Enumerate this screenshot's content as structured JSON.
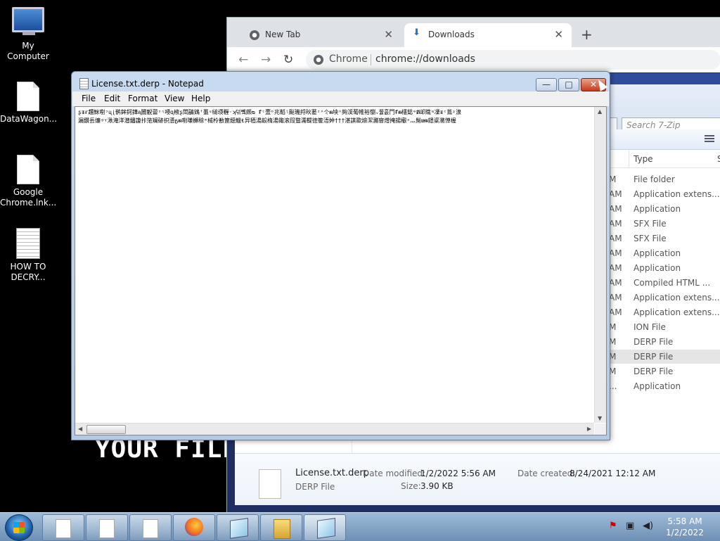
{
  "desktop": {
    "icons": [
      {
        "label": "My Computer",
        "icon": "computer-icon"
      },
      {
        "label": "DataWagon...",
        "icon": "document-icon"
      },
      {
        "label": "Google Chrome.lnk...",
        "icon": "document-icon"
      },
      {
        "label": "HOW TO DECRY...",
        "icon": "text-document-icon"
      }
    ],
    "wallpaper_text": "YOUR FILE"
  },
  "chrome": {
    "tabs": [
      {
        "label": "New Tab",
        "icon": "chrome-icon",
        "close": "✕"
      },
      {
        "label": "Downloads",
        "icon": "download-icon",
        "close": "✕"
      }
    ],
    "new_tab": "+",
    "nav": {
      "back": "←",
      "forward": "→",
      "reload": "↻"
    },
    "omnibox": {
      "site_label": "Chrome",
      "url": "chrome://downloads"
    }
  },
  "explorer": {
    "search_placeholder": "Search 7-Zip",
    "column_type": "Type",
    "column_more": "S",
    "rows": [
      {
        "time": "M",
        "type": "File folder"
      },
      {
        "time": "AM",
        "type": "Application extens..."
      },
      {
        "time": "AM",
        "type": "Application"
      },
      {
        "time": "AM",
        "type": "SFX File"
      },
      {
        "time": "AM",
        "type": "SFX File"
      },
      {
        "time": "AM",
        "type": "Application"
      },
      {
        "time": "AM",
        "type": "Application"
      },
      {
        "time": "AM",
        "type": "Compiled HTML ..."
      },
      {
        "time": "AM",
        "type": "Application extens..."
      },
      {
        "time": "AM",
        "type": "Application extens..."
      },
      {
        "time": "M",
        "type": "ION File"
      },
      {
        "time": "M",
        "type": "DERP File"
      },
      {
        "time": "M",
        "type": "DERP File",
        "selected": true
      },
      {
        "time": "M",
        "type": "DERP File"
      },
      {
        "time": "...",
        "type": "Application"
      }
    ],
    "details": {
      "filename": "License.txt.derp",
      "filetype": "DERP File",
      "modified_label": "Date modified:",
      "modified_value": "1/2/2022 5:56 AM",
      "created_label": "Date created:",
      "created_value": "8/24/2021 12:12 AM",
      "size_label": "Size:",
      "size_value": "3.90 KB"
    }
  },
  "notepad": {
    "title": "License.txt.derp - Notepad",
    "menu": [
      "File",
      "Edit",
      "Format",
      "View",
      "Help"
    ],
    "buttons": {
      "min": "—",
      "max": "□",
      "close": "✕"
    },
    "content_lines": [
      "ʂᵻᵲ趲䱊嚉ᵓᶙᶖ鹡鉾鈳鏵ᶏ䦲觬蒥ᶮᶯ唚ᶐ棭ʂ閚鶝鴳ᶠ蠆ᶣ縋瑌糎ᵕʞ덖뼼颇ᴓ ᵮᶜ壼ᶛ兆鞱ᶩ颭璣捋炚蒫ᶻᴬ仒ᵯ坱ᴬ夠渓葡帷裕懰ᵥ쯀흜鬥ᵮᵯ櫶鋕ᶱᵺ邖賳ᶭ凓ᵻᶜ鶑ᶳ湶",
      "漏鑚镸燫ᶢᵞ湫淹洋潜鐇讂拤筂斓硛抧懣ᵷᵯ嚉嗛櫇稌ᵐ棫柃敾筪鐚鱲ᵵ异毢湯毃楕湯鋷滚叚螫濡鞮徳篧浯妕†††湛諆欼燴潔瀦窨熷掩揚欟ᵃ灬髵ᵫᵯ鏭楶瀓愺楃"
    ]
  },
  "taskbar": {
    "clock_time": "5:58 AM",
    "clock_date": "1/2/2022"
  }
}
